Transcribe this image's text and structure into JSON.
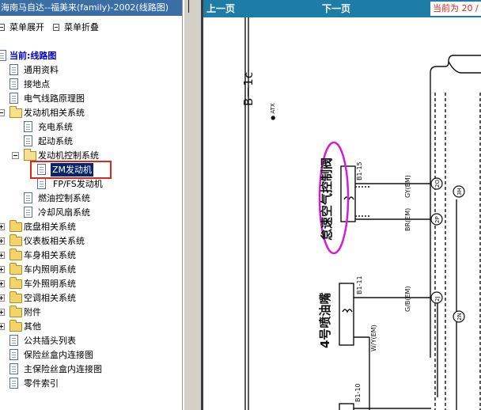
{
  "left_pane": {
    "title": "海南马自达--福美来(family)-2002(线路图)",
    "menu": {
      "expand_label": "菜单展开",
      "collapse_label": "菜单折叠"
    },
    "current_label": "当前:线路图",
    "tree": [
      {
        "label": "通用资料",
        "type": "doc"
      },
      {
        "label": "接地点",
        "type": "doc"
      },
      {
        "label": "电气线路原理图",
        "type": "doc"
      },
      {
        "label": "发动机相关系统",
        "type": "open"
      },
      {
        "label": "充电系统",
        "type": "doc"
      },
      {
        "label": "起动系统",
        "type": "doc"
      },
      {
        "label": "发动机控制系统",
        "type": "open"
      },
      {
        "label": "ZM发动机",
        "type": "doc",
        "selected": true
      },
      {
        "label": "FP/FS发动机",
        "type": "doc"
      },
      {
        "label": "燃油控制系统",
        "type": "doc"
      },
      {
        "label": "冷却风扇系统",
        "type": "doc"
      },
      {
        "label": "底盘相关系统",
        "type": "folder"
      },
      {
        "label": "仪表板相关系统",
        "type": "folder"
      },
      {
        "label": "车身相关系统",
        "type": "folder"
      },
      {
        "label": "车内照明系统",
        "type": "folder"
      },
      {
        "label": "车外照明系统",
        "type": "folder"
      },
      {
        "label": "空调相关系统",
        "type": "folder"
      },
      {
        "label": "附件",
        "type": "folder"
      },
      {
        "label": "其他",
        "type": "folder"
      },
      {
        "label": "公共插头列表",
        "type": "doc"
      },
      {
        "label": "保险丝盒内连接图",
        "type": "doc"
      },
      {
        "label": "主保险丝盒内连接图",
        "type": "doc"
      },
      {
        "label": "零件索引",
        "type": "doc"
      }
    ]
  },
  "nav": {
    "prev_label": "上一页",
    "next_label": "下一页",
    "page_status": "当前为 20 /"
  },
  "diagram": {
    "page_code": "B－1c",
    "atx_label": "● ATX",
    "component_1": "怠速空气控制阀",
    "component_2": "4号喷油嘴",
    "conn_1": "B1-15",
    "conn_2": "B1-11",
    "conn_3": "B1-10",
    "wire_1": "GY(EM)",
    "wire_2": "BR(EM)",
    "wire_3": "G/B(EM)",
    "wire_4": "W/Y(EM)",
    "pin_1": "2O",
    "pin_2": "2P",
    "pin_3": "2J",
    "pin_4": "3H",
    "pin_5": "2N",
    "colors": {
      "title_bar": "#3a6ea5",
      "nav_bar": "#1e7da6",
      "highlight": "#e0251b",
      "ellipse": "#d21fd0",
      "selection": "#0a246a"
    }
  }
}
